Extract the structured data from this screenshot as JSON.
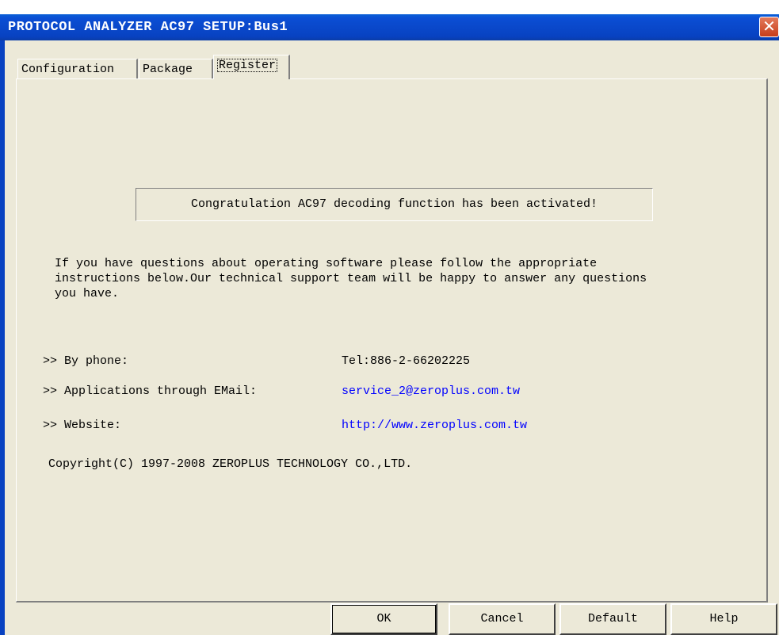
{
  "window": {
    "title": "PROTOCOL ANALYZER AC97 SETUP:Bus1",
    "close_glyph": "✕"
  },
  "tabs": [
    {
      "label": "Configuration",
      "active": false
    },
    {
      "label": "Package",
      "active": false
    },
    {
      "label": "Register",
      "active": true
    }
  ],
  "register": {
    "activation_message": "Congratulation AC97 decoding function has been activated!",
    "info_text": "If you have questions about operating software please follow the appropriate\ninstructions below.Our technical support team will be happy to answer any questions\nyou have.",
    "contacts": [
      {
        "label": ">> By phone:",
        "value": "Tel:886-2-66202225",
        "is_link": false
      },
      {
        "label": ">> Applications through EMail:",
        "value": "service_2@zeroplus.com.tw",
        "is_link": true
      },
      {
        "label": ">> Website:",
        "value": "http://www.zeroplus.com.tw",
        "is_link": true
      }
    ],
    "copyright": "Copyright(C) 1997-2008 ZEROPLUS TECHNOLOGY CO.,LTD."
  },
  "buttons": {
    "ok": "OK",
    "cancel": "Cancel",
    "default": "Default",
    "help": "Help"
  },
  "colors": {
    "titlebar": "#0842c1",
    "dialog_background": "#ece9d8",
    "link": "#0000ff",
    "close_button": "#c83d1a"
  }
}
